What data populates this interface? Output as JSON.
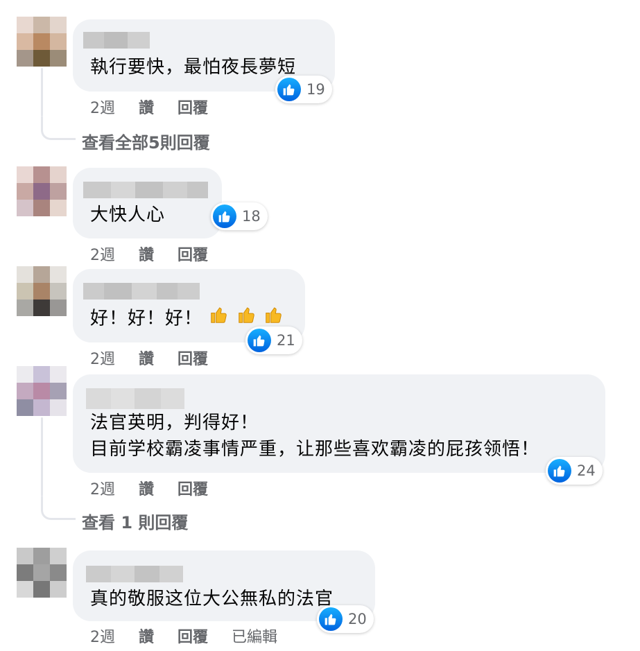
{
  "comments": [
    {
      "text_lines": [
        "執行要快，最怕夜長夢短"
      ],
      "reactions": 19,
      "actions": {
        "time": "2週",
        "like": "讚",
        "reply": "回覆"
      },
      "view_replies": "查看全部5則回覆"
    },
    {
      "text_lines": [
        "大快人心"
      ],
      "reactions": 18,
      "actions": {
        "time": "2週",
        "like": "讚",
        "reply": "回覆"
      }
    },
    {
      "text_lines": [
        "好！好！好！"
      ],
      "emoji": [
        "thumbs-up-emoji",
        "thumbs-up-emoji",
        "thumbs-up-emoji"
      ],
      "reactions": 21,
      "actions": {
        "time": "2週",
        "like": "讚",
        "reply": "回覆"
      }
    },
    {
      "text_lines": [
        "法官英明，判得好！",
        "目前学校霸凌事情严重，让那些喜欢霸凌的屁孩领悟！"
      ],
      "reactions": 24,
      "actions": {
        "time": "2週",
        "like": "讚",
        "reply": "回覆"
      },
      "view_replies": "查看 1 則回覆"
    },
    {
      "text_lines": [
        "真的敬服这位大公無私的法官"
      ],
      "reactions": 20,
      "actions": {
        "time": "2週",
        "like": "讚",
        "reply": "回覆",
        "edited": "已編輯"
      }
    }
  ],
  "icons": {
    "reaction": "like-reaction-icon"
  },
  "colors": {
    "bubble": "#f0f2f5",
    "like_blue": "#1877f2",
    "meta_text": "#65676b"
  }
}
